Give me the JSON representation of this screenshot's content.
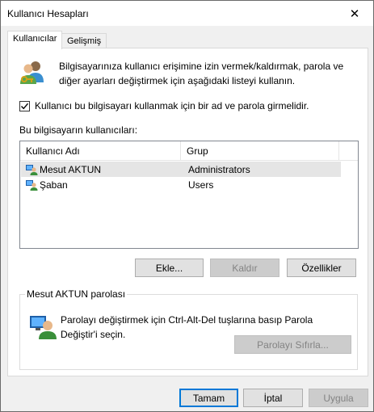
{
  "window": {
    "title": "Kullanıcı Hesapları",
    "close_glyph": "✕"
  },
  "tabs": [
    {
      "label": "Kullanıcılar",
      "active": true
    },
    {
      "label": "Gelişmiş",
      "active": false
    }
  ],
  "intro": {
    "text": "Bilgisayarınıza kullanıcı erişimine izin vermek/kaldırmak, parola ve diğer ayarları değiştirmek için aşağıdaki listeyi kullanın."
  },
  "require_login": {
    "label": "Kullanıcı bu bilgisayarı kullanmak için bir ad ve parola girmelidir.",
    "checked": true
  },
  "users": {
    "label": "Bu bilgisayarın kullanıcıları:",
    "columns": [
      "Kullanıcı Adı",
      "Grup"
    ],
    "rows": [
      {
        "name": "Mesut AKTUN",
        "group": "Administrators",
        "selected": true
      },
      {
        "name": "Şaban",
        "group": "Users",
        "selected": false
      }
    ]
  },
  "actions": {
    "add": "Ekle...",
    "remove": "Kaldır",
    "properties": "Özellikler"
  },
  "password_group": {
    "title": "Mesut AKTUN parolası",
    "text": "Parolayı değiştirmek için Ctrl-Alt-Del tuşlarına basıp Parola Değiştir'i seçin.",
    "reset_button": "Parolayı Sıfırla..."
  },
  "footer": {
    "ok": "Tamam",
    "cancel": "İptal",
    "apply": "Uygula"
  },
  "colors": {
    "accent": "#0078d7",
    "selection": "#e5e5e5"
  }
}
